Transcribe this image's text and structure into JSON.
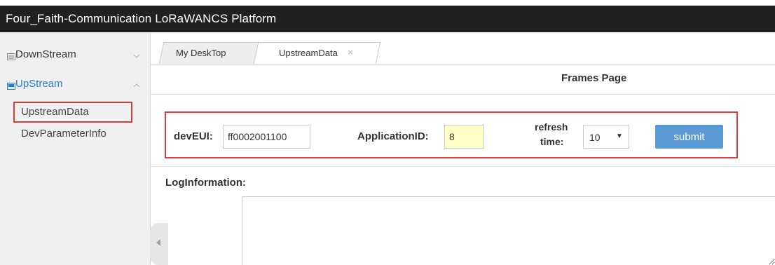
{
  "app": {
    "title": "Four_Faith-Communication LoRaWANCS Platform"
  },
  "sidebar": {
    "groups": [
      {
        "label": "DownStream",
        "icon": "list-icon",
        "expanded": false,
        "items": []
      },
      {
        "label": "UpStream",
        "icon": "monitor-icon",
        "expanded": true,
        "items": [
          {
            "label": "UpstreamData",
            "highlighted": true
          },
          {
            "label": "DevParameterInfo",
            "highlighted": false
          }
        ]
      }
    ]
  },
  "tabs": [
    {
      "label": "My DeskTop",
      "active": false,
      "closable": false
    },
    {
      "label": "UpstreamData",
      "active": true,
      "closable": true,
      "close_glyph": "×"
    }
  ],
  "frame": {
    "title": "Frames Page"
  },
  "form": {
    "dev_eui_label": "devEUI:",
    "dev_eui_value": "ff0002001100",
    "application_id_label": "ApplicationID:",
    "application_id_value": "8",
    "refresh_label_line1": "refresh",
    "refresh_label_line2": "time:",
    "refresh_value": "10",
    "submit_label": "submit"
  },
  "log": {
    "label": "LogInformation:",
    "content": ""
  },
  "colors": {
    "header_bg": "#212121",
    "accent_blue": "#2a7ec9",
    "submit_bg": "#5b9bd5",
    "highlight_red": "#e03b3b",
    "input_highlight": "#ffffc8"
  }
}
